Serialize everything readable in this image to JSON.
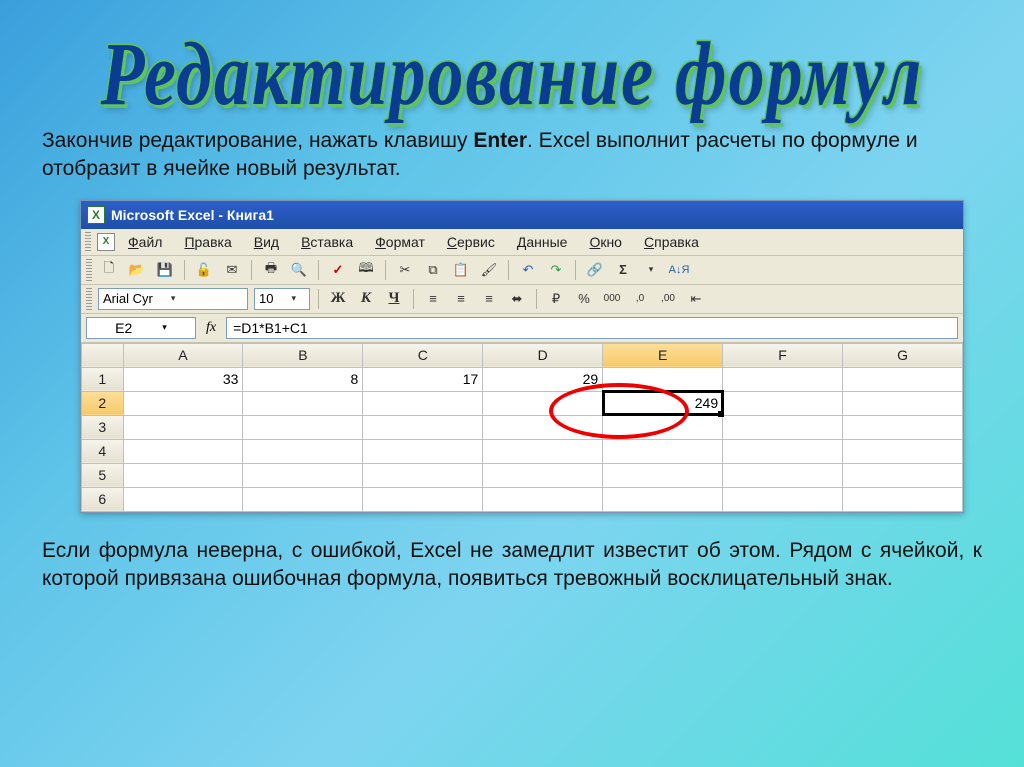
{
  "slide": {
    "title": "Редактирование формул",
    "para1_a": "Закончив редактирование, нажать клавишу ",
    "para1_b": "Enter",
    "para1_c": ". Excel выполнит расчеты по формуле и отобразит в ячейке новый результат.",
    "para2": "Если формула неверна, с ошибкой, Excel не замедлит  известит об этом. Рядом с ячейкой, к которой привязана ошибочная формула, появиться тревожный восклицательный знак."
  },
  "app": {
    "title": "Microsoft Excel - Книга1"
  },
  "menu": [
    "Файл",
    "Правка",
    "Вид",
    "Вставка",
    "Формат",
    "Сервис",
    "Данные",
    "Окно",
    "Справка"
  ],
  "format": {
    "font": "Arial Cyr",
    "size": "10",
    "bold": "Ж",
    "italic": "К",
    "underline": "Ч",
    "pct": "%",
    "thou": "000",
    "dec1": ",0",
    "dec2": ",00"
  },
  "formula": {
    "cell": "E2",
    "fx": "fx",
    "content": "=D1*B1+C1"
  },
  "grid": {
    "cols": [
      "A",
      "B",
      "C",
      "D",
      "E",
      "F",
      "G"
    ],
    "rows": [
      "1",
      "2",
      "3",
      "4",
      "5",
      "6"
    ],
    "r1": {
      "A": "33",
      "B": "8",
      "C": "17",
      "D": "29",
      "E": "",
      "F": "",
      "G": ""
    },
    "r2": {
      "A": "",
      "B": "",
      "C": "",
      "D": "",
      "E": "249",
      "F": "",
      "G": ""
    }
  }
}
